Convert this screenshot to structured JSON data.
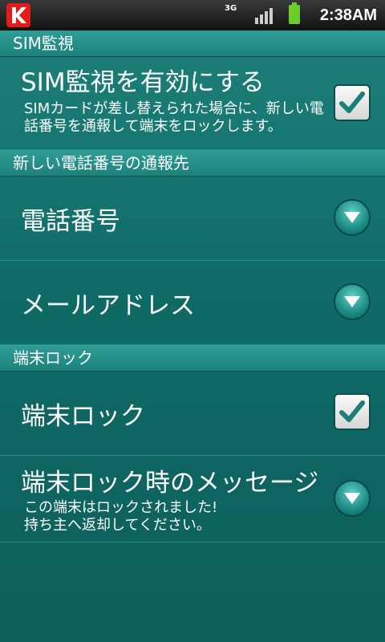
{
  "status_bar": {
    "network": "3G",
    "time": "2:38AM",
    "app_icon": "kaspersky-k-icon"
  },
  "sections": {
    "sim_watch": {
      "header": "SIM監視",
      "enable_title": "SIM監視を有効にする",
      "enable_desc": "SIMカードが差し替えられた場合に、新しい電話番号を通報して端末をロックします。",
      "enable_checked": true
    },
    "notify": {
      "header": "新しい電話番号の通報先",
      "phone_title": "電話番号",
      "mail_title": "メールアドレス"
    },
    "lock": {
      "header": "端末ロック",
      "lock_title": "端末ロック",
      "lock_checked": true,
      "message_title": "端末ロック時のメッセージ",
      "message_desc": "この端末はロックされました!\n持ち主へ返却してください。"
    }
  },
  "colors": {
    "background": "#116f69",
    "header": "#2f9d96",
    "checkbox_check": "#1a7f77"
  }
}
